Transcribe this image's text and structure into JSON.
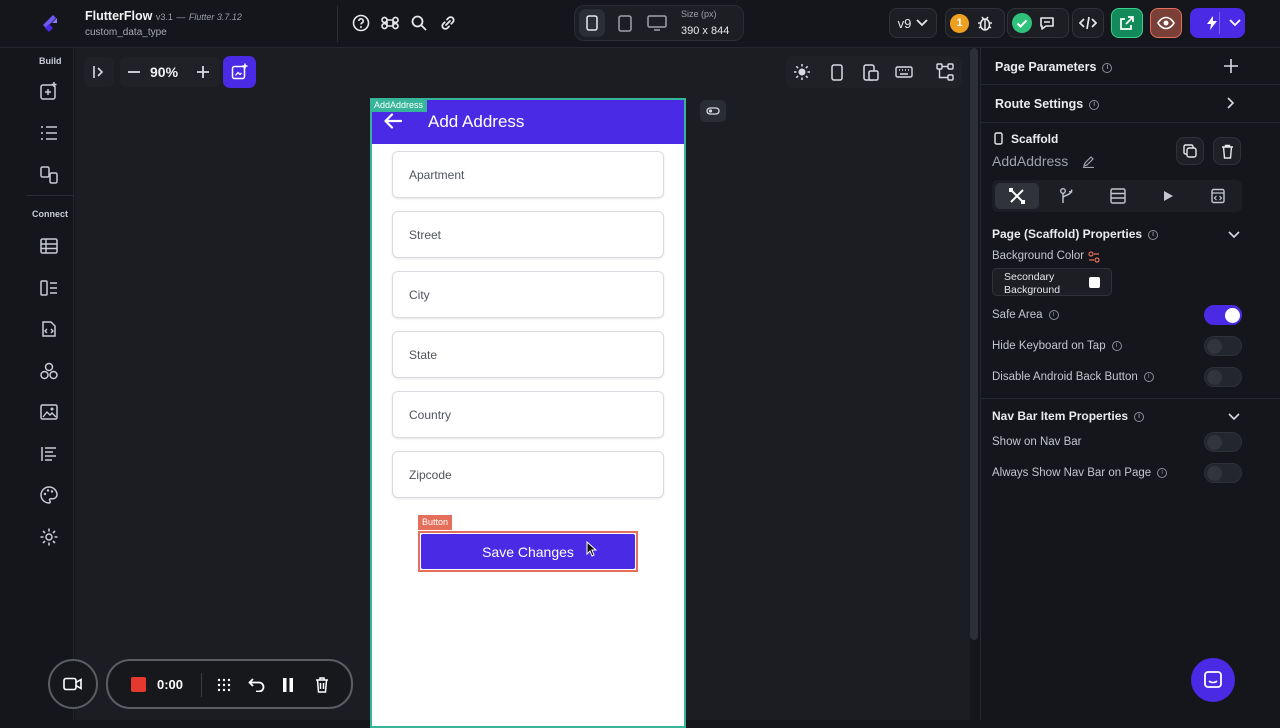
{
  "app": {
    "brand": "FlutterFlow",
    "version": "v3.1",
    "flutter_version": "Flutter 3.7.12",
    "project": "custom_data_type"
  },
  "topbar": {
    "size_label": "Size (px)",
    "size_value": "390 x 844",
    "version_badge": "v9",
    "notification_count": "1"
  },
  "rail": {
    "build_label": "Build",
    "connect_label": "Connect"
  },
  "canvas": {
    "zoom": "90%"
  },
  "page": {
    "tag": "AddAddress",
    "title": "Add Address",
    "fields": [
      {
        "label": "Apartment"
      },
      {
        "label": "Street"
      },
      {
        "label": "City"
      },
      {
        "label": "State"
      },
      {
        "label": "Country"
      },
      {
        "label": "Zipcode"
      }
    ],
    "button_tag": "Button",
    "button_label": "Save Changes"
  },
  "panel": {
    "page_parameters": "Page Parameters",
    "route_settings": "Route Settings",
    "widget_type": "Scaffold",
    "widget_name": "AddAddress",
    "scaffold_props_title": "Page (Scaffold) Properties",
    "background_color_label": "Background Color",
    "background_color_value": "Secondary Background",
    "safe_area_label": "Safe Area",
    "safe_area_on": true,
    "hide_keyboard_label": "Hide Keyboard on Tap",
    "disable_back_label": "Disable Android Back Button",
    "navbar_title": "Nav Bar Item Properties",
    "show_navbar_label": "Show on Nav Bar",
    "always_show_navbar_label": "Always Show Nav Bar on Page"
  },
  "recorder": {
    "time": "0:00"
  },
  "colors": {
    "accent": "#4b2ae6",
    "phone_outline": "#36b59a",
    "selection": "#e46f5b",
    "notification": "#f0a020",
    "success": "#2fc27a",
    "record": "#e5392f"
  }
}
